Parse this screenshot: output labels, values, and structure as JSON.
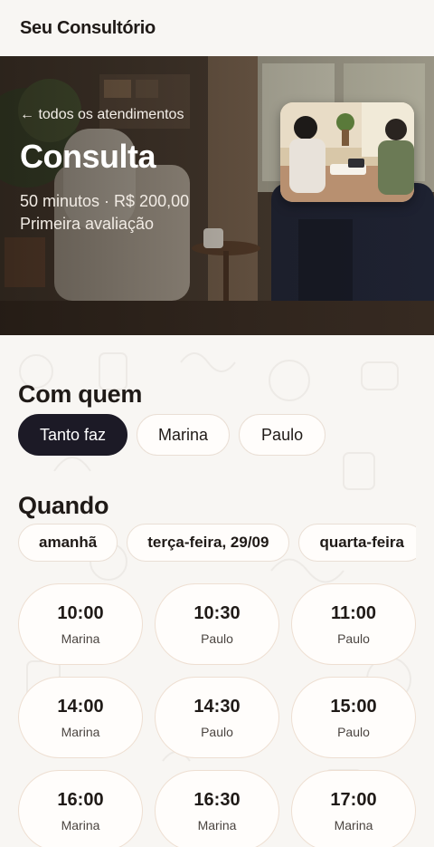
{
  "header": {
    "brand": "Seu Consultório"
  },
  "hero": {
    "back_link": "← todos os atendimentos",
    "title": "Consulta",
    "meta": "50 minutos · R$ 200,00",
    "subtitle": "Primeira avaliação"
  },
  "with_whom": {
    "title": "Com quem",
    "options": [
      "Tanto faz",
      "Marina",
      "Paulo"
    ],
    "selected": "Tanto faz"
  },
  "when": {
    "title": "Quando",
    "days": [
      "amanhã",
      "terça-feira, 29/09",
      "quarta-feira"
    ],
    "slots": [
      {
        "time": "10:00",
        "staff": "Marina"
      },
      {
        "time": "10:30",
        "staff": "Paulo"
      },
      {
        "time": "11:00",
        "staff": "Paulo"
      },
      {
        "time": "14:00",
        "staff": "Marina"
      },
      {
        "time": "14:30",
        "staff": "Paulo"
      },
      {
        "time": "15:00",
        "staff": "Paulo"
      },
      {
        "time": "16:00",
        "staff": "Marina"
      },
      {
        "time": "16:30",
        "staff": "Marina"
      },
      {
        "time": "17:00",
        "staff": "Marina"
      }
    ]
  },
  "colors": {
    "selected_chip": "#1c1a26",
    "background": "#f8f6f3",
    "border": "#eadfd5"
  }
}
